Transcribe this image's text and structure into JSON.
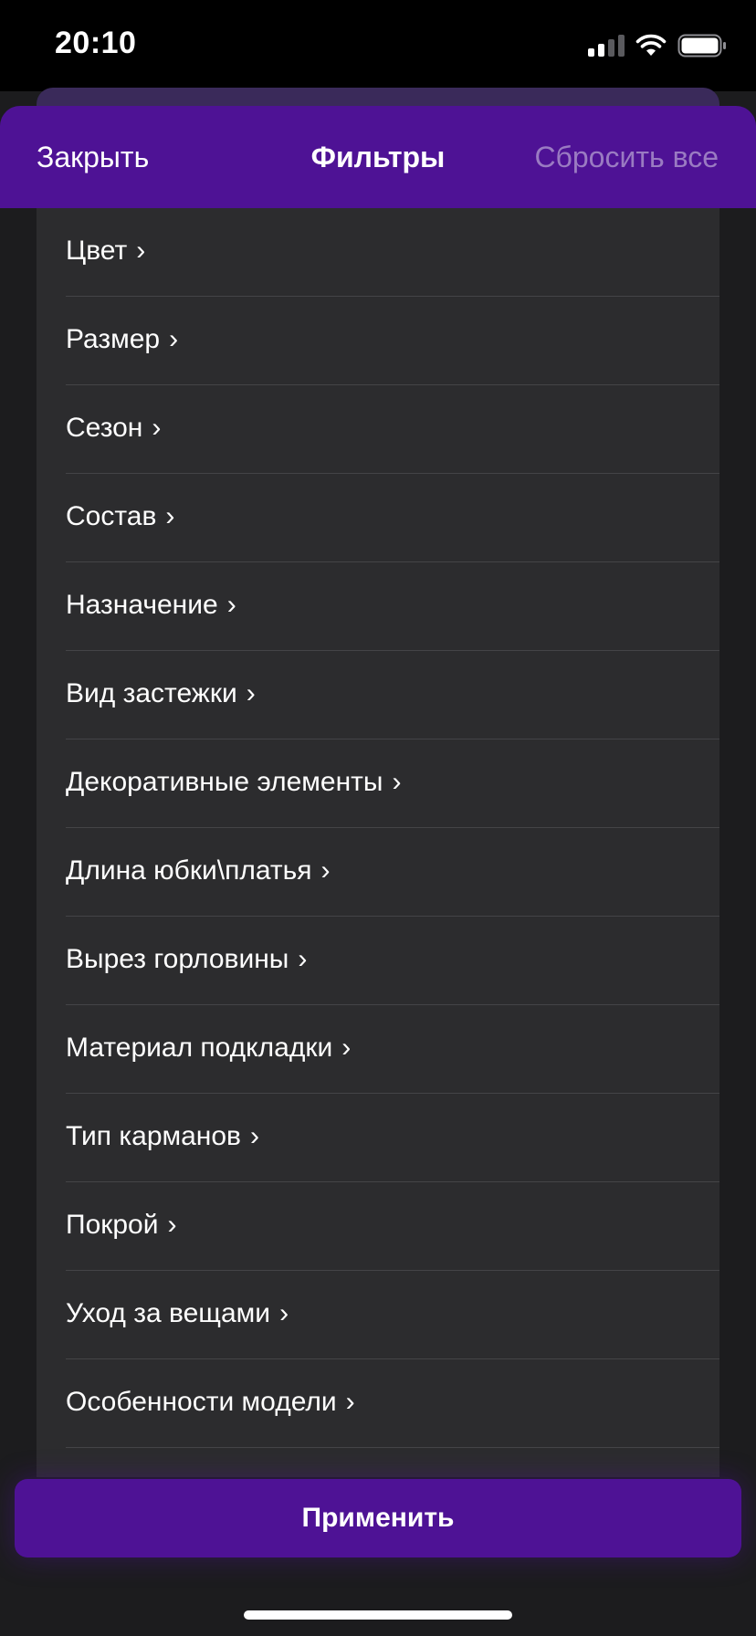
{
  "status_bar": {
    "time": "20:10"
  },
  "header": {
    "close_label": "Закрыть",
    "title": "Фильтры",
    "reset_label": "Сбросить все"
  },
  "filters": {
    "chevron": "›",
    "items": [
      "Цвет",
      "Размер",
      "Сезон",
      "Состав",
      "Назначение",
      "Вид застежки",
      "Декоративные элементы",
      "Длина юбки\\платья",
      "Вырез горловины",
      "Материал подкладки",
      "Тип карманов",
      "Покрой",
      "Уход за вещами",
      "Особенности модели"
    ]
  },
  "footer": {
    "apply_label": "Применить"
  },
  "colors": {
    "accent": "#4e1295",
    "list_bg": "#2c2c2e",
    "reset_text": "#9a7bc2"
  }
}
